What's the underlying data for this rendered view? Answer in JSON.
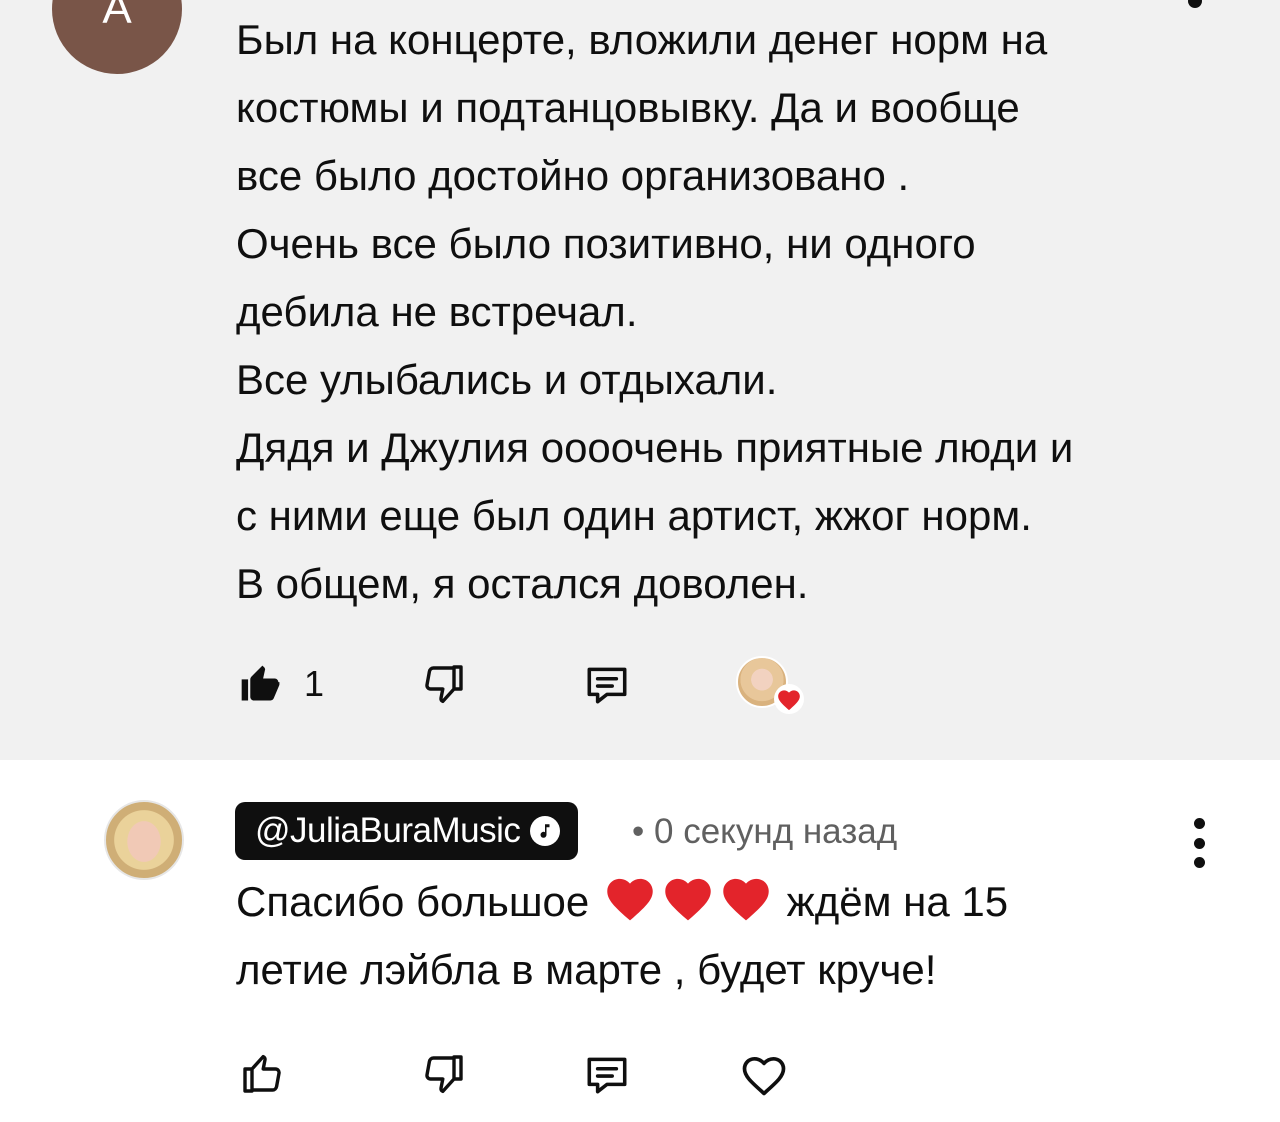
{
  "comment_1": {
    "avatar_letter": "А",
    "lines": [
      "Был на концерте, вложили денег норм на",
      "костюмы и подтанцовывку. Да и вообще",
      "все было достойно организовано .",
      "Очень все было позитивно, ни одного",
      "дебила не встречал.",
      "Все улыбались и отдыхали.",
      "Дядя и Джулия оооочень приятные люди и",
      "с ними еще был один артист, жжог норм.",
      "В общем, я остался доволен."
    ],
    "like_count": "1",
    "icons": {
      "like": "thumbs-up-filled-icon",
      "dislike": "thumbs-down-icon",
      "reply": "reply-comment-icon",
      "creator_heart": "creator-heart-icon"
    }
  },
  "comment_2": {
    "author_handle": "@JuliaBuraMusic",
    "separator": "•",
    "time": "0 секунд назад",
    "text_part_1": "Спасибо большое",
    "text_part_2": "ждём на 15",
    "line_2": "летие лэйбла в марте , будет круче!",
    "heart_emoji_count": 3,
    "icons": {
      "like": "thumbs-up-icon",
      "dislike": "thumbs-down-icon",
      "reply": "reply-comment-icon",
      "heart": "heart-outline-icon",
      "verified": "music-note-verified-icon",
      "more": "more-vertical-icon"
    }
  },
  "colors": {
    "highlight_bg": "#f1f1f1",
    "text": "#0f0f0f",
    "secondary_text": "#606060",
    "avatar_bg": "#795548",
    "heart_red": "#e3242b"
  }
}
